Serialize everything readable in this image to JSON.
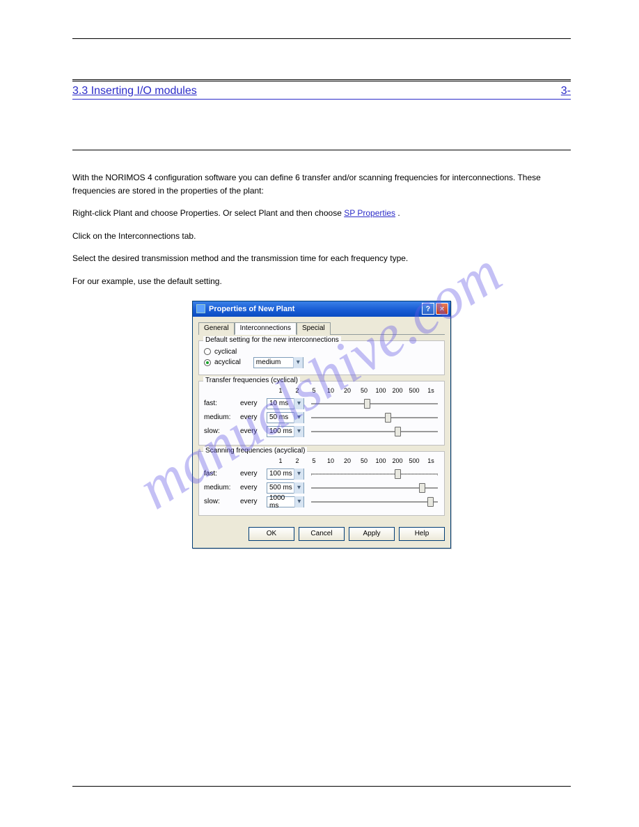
{
  "watermark": "manualshive.com",
  "section_link": "3.3 Inserting I/O modules",
  "section_tab": "3-",
  "body": {
    "p1": "With the NORIMOS 4 configuration software you can define 6 transfer and/or scanning frequencies for interconnections. These frequencies are stored in the properties of the plant:",
    "p2a": "Right-click Plant and choose Properties. Or select Plant and then choose ",
    "p2b": "SP Properties",
    "p2c": ".",
    "p3": "Click on the Interconnections tab.",
    "p4": "Select the desired transmission method and the transmission time for each frequency type.",
    "p5": "For our example, use the default setting."
  },
  "dialog": {
    "title": "Properties of New Plant",
    "help_btn": "?",
    "close_btn": "×",
    "tabs": {
      "general": "General",
      "interconnections": "Interconnections",
      "special": "Special"
    },
    "group_default": {
      "title": "Default setting for the new interconnections",
      "cyclical": "cyclical",
      "acyclical": "acyclical",
      "mode_value": "medium"
    },
    "group_transfer": {
      "title": "Transfer frequencies (cyclical)",
      "ticks": [
        "1",
        "2",
        "5",
        "10",
        "20",
        "50",
        "100",
        "200",
        "500",
        "1s"
      ],
      "rows": [
        {
          "label": "fast:",
          "every": "every",
          "value": "10 ms",
          "thumb": 42
        },
        {
          "label": "medium:",
          "every": "every",
          "value": "50 ms",
          "thumb": 58
        },
        {
          "label": "slow:",
          "every": "every",
          "value": "100 ms",
          "thumb": 66
        }
      ]
    },
    "group_scanning": {
      "title": "Scanning frequencies (acyclical)",
      "ticks": [
        "1",
        "2",
        "5",
        "10",
        "20",
        "50",
        "100",
        "200",
        "500",
        "1s"
      ],
      "rows": [
        {
          "label": "fast:",
          "every": "every",
          "value": "100 ms",
          "thumb": 66
        },
        {
          "label": "medium:",
          "every": "every",
          "value": "500 ms",
          "thumb": 85
        },
        {
          "label": "slow:",
          "every": "every",
          "value": "1000 ms",
          "thumb": 92
        }
      ]
    },
    "buttons": {
      "ok": "OK",
      "cancel": "Cancel",
      "apply": "Apply",
      "help": "Help"
    }
  },
  "footer": {
    "left": "",
    "right": ""
  }
}
